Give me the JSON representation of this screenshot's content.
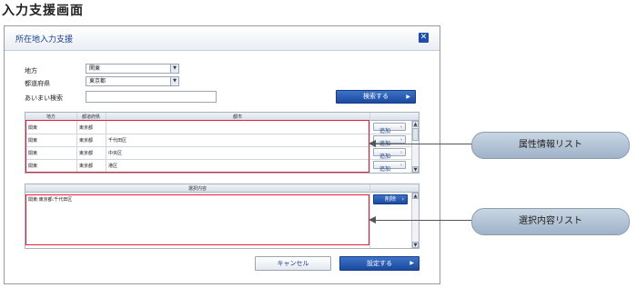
{
  "page_title": "入力支援画面",
  "dialog": {
    "title": "所在地入力支援",
    "fields": {
      "region_label": "地方",
      "region_value": "関東",
      "prefecture_label": "都道府県",
      "prefecture_value": "東京都",
      "fuzzy_label": "あいまい検索",
      "fuzzy_value": ""
    },
    "search_button": "検索する",
    "attr_table": {
      "columns": [
        "地方",
        "都道府県",
        "都市"
      ],
      "rows": [
        {
          "region": "関東",
          "pref": "東京都",
          "city": ""
        },
        {
          "region": "関東",
          "pref": "東京都",
          "city": "千代田区"
        },
        {
          "region": "関東",
          "pref": "東京都",
          "city": "中央区"
        },
        {
          "region": "関東",
          "pref": "東京都",
          "city": "港区"
        }
      ],
      "add_label": "追加",
      "arrow_glyph": "›"
    },
    "selected_table": {
      "header": "選択内容",
      "items": [
        "関東:東京都:千代田区"
      ],
      "delete_label": "削除"
    },
    "cancel_button": "キャンセル",
    "confirm_button": "設定する"
  },
  "callouts": {
    "attribute_list": "属性情報リスト",
    "selection_list": "選択内容リスト"
  },
  "colors": {
    "accent_blue": "#1f4fa8",
    "highlight_red": "#e0203c"
  }
}
